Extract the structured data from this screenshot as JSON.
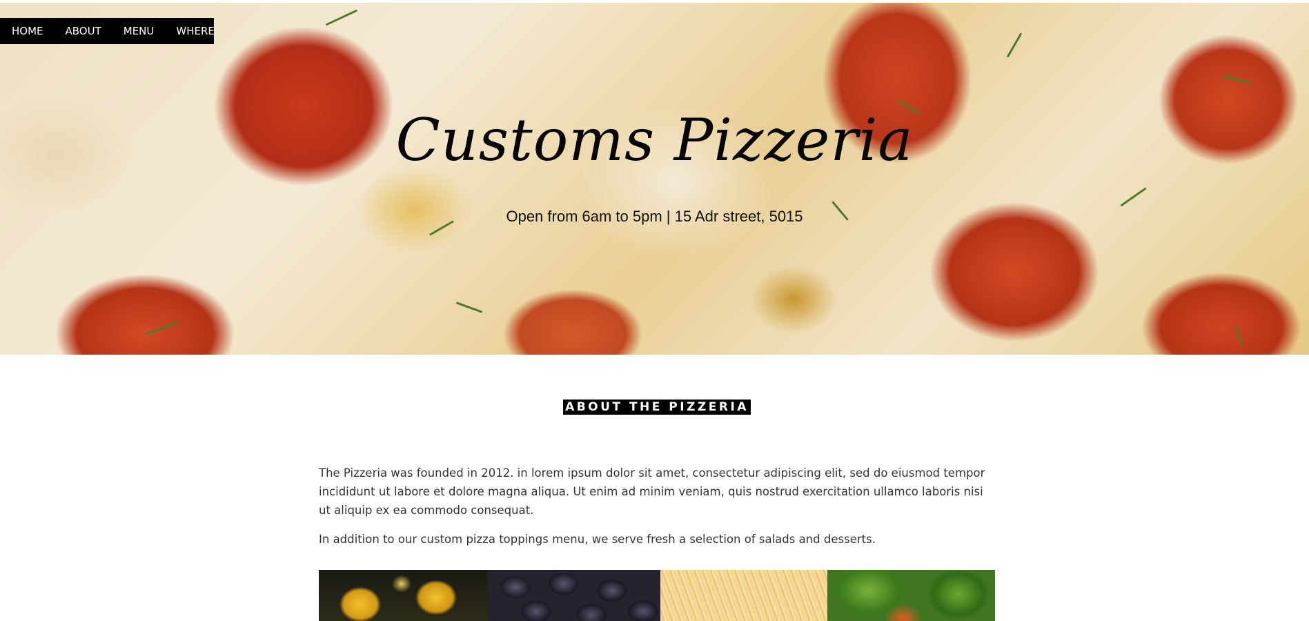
{
  "nav": {
    "items": [
      {
        "label": "HOME"
      },
      {
        "label": "ABOUT"
      },
      {
        "label": "MENU"
      },
      {
        "label": "WHERE"
      }
    ]
  },
  "hero": {
    "title": "Customs Pizzeria",
    "subtitle": "Open from 6am to 5pm | 15 Adr street, 5015"
  },
  "about": {
    "heading": "ABOUT THE PIZZERIA",
    "paragraphs": [
      "The Pizzeria was founded in 2012. in lorem ipsum dolor sit amet, consectetur adipiscing elit, sed do eiusmod tempor incididunt ut labore et dolore magna aliqua. Ut enim ad minim veniam, quis nostrud exercitation ullamco laboris nisi ut aliquip ex ea commodo consequat.",
      "In addition to our custom pizza toppings menu, we serve fresh a selection of salads and desserts."
    ]
  },
  "gallery": {
    "images": [
      "pineapple-image",
      "olives-image",
      "cheese-image",
      "peppers-image"
    ]
  },
  "colors": {
    "nav_background": "#000000",
    "nav_text": "#ffffff",
    "heading_background": "#000000",
    "body_text": "#333333"
  }
}
